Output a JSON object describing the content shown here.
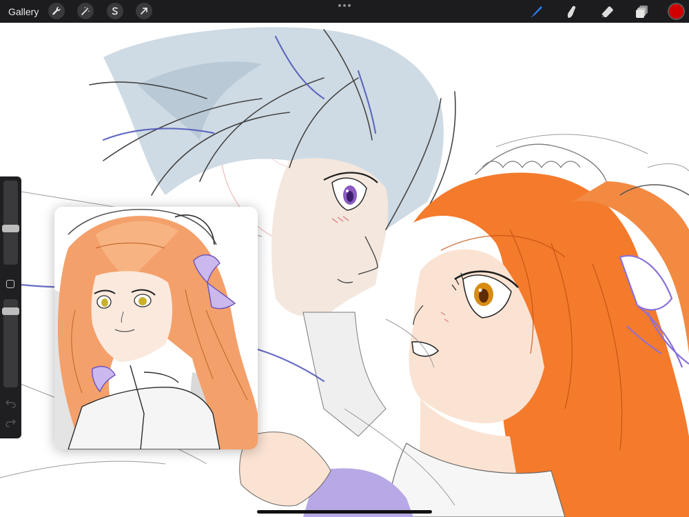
{
  "toolbar": {
    "gallery_label": "Gallery",
    "left_tools": [
      {
        "name": "actions",
        "icon": "wrench-icon"
      },
      {
        "name": "adjustments",
        "icon": "magic-wand-icon"
      },
      {
        "name": "selection",
        "icon": "selection-s-icon"
      },
      {
        "name": "transform",
        "icon": "arrow-cursor-icon"
      }
    ],
    "right_tools": [
      {
        "name": "brush",
        "icon": "brush-icon",
        "active": true
      },
      {
        "name": "smudge",
        "icon": "smudge-icon"
      },
      {
        "name": "eraser",
        "icon": "eraser-icon"
      },
      {
        "name": "layers",
        "icon": "layers-icon"
      }
    ],
    "current_color": "#d10000",
    "active_color": "#2f7bf6"
  },
  "sidebar": {
    "brush_size_level": 0.42,
    "opacity_level": 0.9,
    "icons": [
      "modify-square-icon",
      "undo-icon",
      "redo-icon"
    ]
  },
  "colors": {
    "toolbar_bg": "#1c1c1e",
    "hair_orange": "#f47a2c",
    "hair_blue_gray": "#cfdbe4",
    "skin": "#fbe3d3",
    "ribbon_purple": "#b9a6e6"
  }
}
